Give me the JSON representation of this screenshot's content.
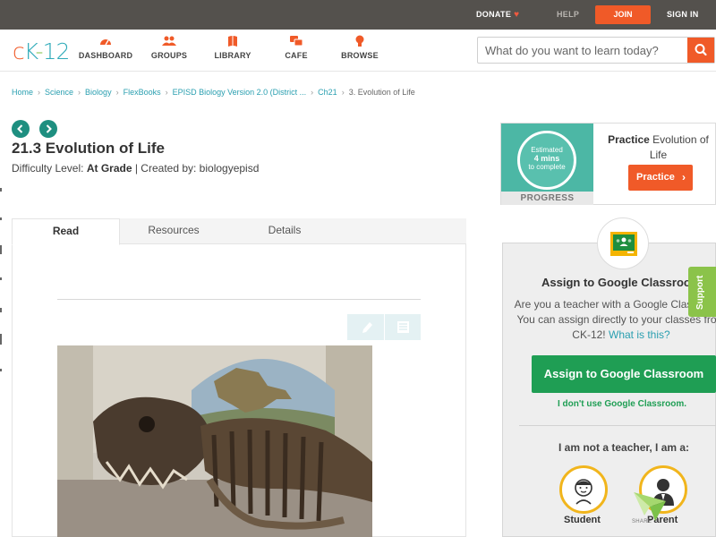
{
  "topbar": {
    "donate": "DONATE",
    "help": "HELP",
    "join": "JOIN",
    "signin": "SIGN IN"
  },
  "nav": {
    "logo": "ck-12",
    "items": [
      "DASHBOARD",
      "GROUPS",
      "LIBRARY",
      "CAFE",
      "BROWSE"
    ],
    "search_placeholder": "What do you want to learn today?"
  },
  "breadcrumb": [
    "Home",
    "Science",
    "Biology",
    "FlexBooks",
    "EPISD Biology Version 2.0 (District ...",
    "Ch21",
    "3. Evolution of Life"
  ],
  "lesson": {
    "title": "21.3 Evolution of Life",
    "difficulty_label": "Difficulty Level:",
    "difficulty_value": "At Grade",
    "created_by": "| Created by: biologyepisd"
  },
  "tabs": [
    "Read",
    "Resources",
    "Details"
  ],
  "practice": {
    "estimated": "Estimated",
    "mins": "4 mins",
    "to_complete": "to complete",
    "progress_label": "PROGRESS",
    "title_bold": "Practice",
    "title_rest": "Evolution of Life",
    "button": "Practice"
  },
  "google_classroom": {
    "title": "Assign to Google Classroom",
    "desc": "Are you a teacher with a Google Classroom? You can assign directly to your classes from CK-12!",
    "what_link": "What is this?",
    "assign_button": "Assign to Google Classroom",
    "no_use": "I don't use Google Classroom.",
    "not_teacher": "I am not a teacher, I am a:",
    "roles": [
      "Student",
      "Parent"
    ]
  },
  "support": "Support",
  "share": "SHARE"
}
